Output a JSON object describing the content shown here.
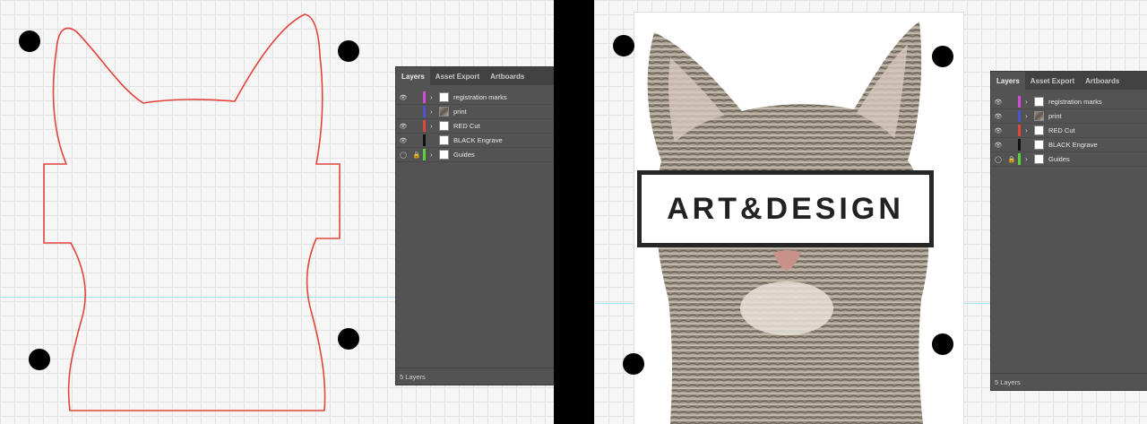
{
  "left_panel": {
    "tabs": [
      {
        "label": "Layers",
        "active": true
      },
      {
        "label": "Asset Export",
        "active": false
      },
      {
        "label": "Artboards",
        "active": false
      }
    ],
    "layers": [
      {
        "name": "registration marks",
        "visible": true,
        "locked": false,
        "color": "#d24bd6",
        "thumb": "blank"
      },
      {
        "name": "print",
        "visible": false,
        "locked": false,
        "color": "#4d52d0",
        "thumb": "image"
      },
      {
        "name": "RED Cut",
        "visible": true,
        "locked": false,
        "color": "#e2453a",
        "thumb": "blank"
      },
      {
        "name": "BLACK Engrave",
        "visible": true,
        "locked": false,
        "color": "#111111",
        "thumb": "blank"
      },
      {
        "name": "Guides",
        "visible": "template",
        "locked": true,
        "color": "#5cd13f",
        "thumb": "blank"
      }
    ],
    "footer": "5 Layers"
  },
  "right_panel": {
    "tabs": [
      {
        "label": "Layers",
        "active": true
      },
      {
        "label": "Asset Export",
        "active": false
      },
      {
        "label": "Artboards",
        "active": false
      }
    ],
    "layers": [
      {
        "name": "registration marks",
        "visible": true,
        "locked": false,
        "color": "#d24bd6",
        "thumb": "blank"
      },
      {
        "name": "print",
        "visible": true,
        "locked": false,
        "color": "#4d52d0",
        "thumb": "image"
      },
      {
        "name": "RED Cut",
        "visible": true,
        "locked": false,
        "color": "#e2453a",
        "thumb": "blank"
      },
      {
        "name": "BLACK Engrave",
        "visible": true,
        "locked": false,
        "color": "#111111",
        "thumb": "blank"
      },
      {
        "name": "Guides",
        "visible": "template",
        "locked": true,
        "color": "#5cd13f",
        "thumb": "blank"
      }
    ],
    "footer": "5 Layers"
  },
  "artwork": {
    "banner_text": "ART&DESIGN",
    "cut_line_color": "#e2453a"
  }
}
